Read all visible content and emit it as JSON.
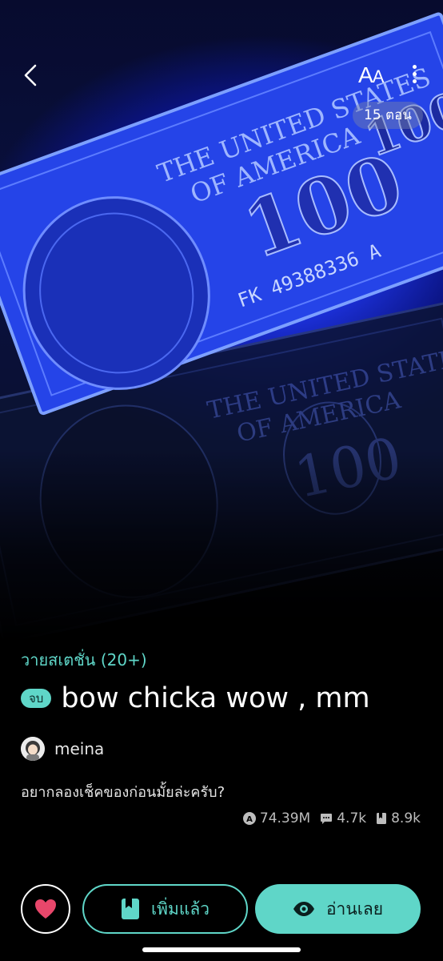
{
  "header": {
    "font_label": "A",
    "font_label_small": "A",
    "episodes": "15 ตอน"
  },
  "info": {
    "genre": "วายสเตชั่น (20+)",
    "status": "จบ",
    "title": "bow chicka wow , mm",
    "author": "meina",
    "description": "อยากลองเช็คของก่อนมั้ยล่ะครับ?"
  },
  "stats": {
    "views": "74.39M",
    "comments": "4.7k",
    "bookmarks": "8.9k"
  },
  "actions": {
    "added_label": "เพิ่มแล้ว",
    "read_label": "อ่านเลย"
  },
  "colors": {
    "accent": "#5fd6c8",
    "like": "#e8476b"
  }
}
